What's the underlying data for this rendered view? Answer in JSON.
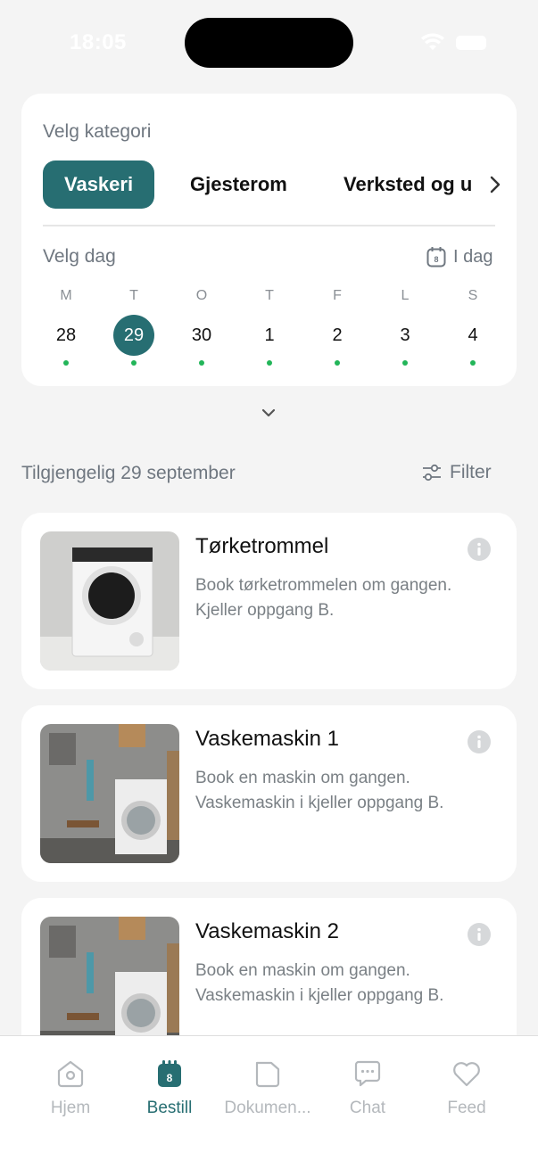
{
  "status": {
    "time": "18:05"
  },
  "category": {
    "label": "Velg kategori",
    "chips": [
      "Vaskeri",
      "Gjesterom",
      "Verksted og u"
    ],
    "selected": "Vaskeri"
  },
  "calendar": {
    "label": "Velg dag",
    "today_label": "I dag",
    "today_icon_number": "8",
    "weekdays": [
      "M",
      "T",
      "O",
      "T",
      "F",
      "L",
      "S"
    ],
    "dates": [
      "28",
      "29",
      "30",
      "1",
      "2",
      "3",
      "4"
    ],
    "selected": "29"
  },
  "available": {
    "title": "Tilgjengelig 29 september",
    "filter_label": "Filter"
  },
  "items": [
    {
      "title": "Tørketrommel",
      "desc_line1": "Book tørketrommelen om gangen.",
      "desc_line2": "Kjeller oppgang B.",
      "image": "tumble-dryer"
    },
    {
      "title": "Vaskemaskin 1",
      "desc_line1": "Book en maskin om gangen.",
      "desc_line2": "Vaskemaskin i kjeller oppgang B.",
      "image": "washing-machine"
    },
    {
      "title": "Vaskemaskin 2",
      "desc_line1": "Book en maskin om gangen.",
      "desc_line2": "Vaskemaskin i kjeller oppgang B.",
      "image": "washing-machine"
    }
  ],
  "tabs": [
    {
      "label": "Hjem",
      "icon": "home-icon"
    },
    {
      "label": "Bestill",
      "icon": "calendar-icon",
      "badge": "8",
      "active": true
    },
    {
      "label": "Dokumen...",
      "icon": "folder-icon"
    },
    {
      "label": "Chat",
      "icon": "chat-icon"
    },
    {
      "label": "Feed",
      "icon": "heart-icon"
    }
  ],
  "colors": {
    "accent": "#276e72",
    "dot": "#22b559",
    "background": "#f4f4f4"
  }
}
